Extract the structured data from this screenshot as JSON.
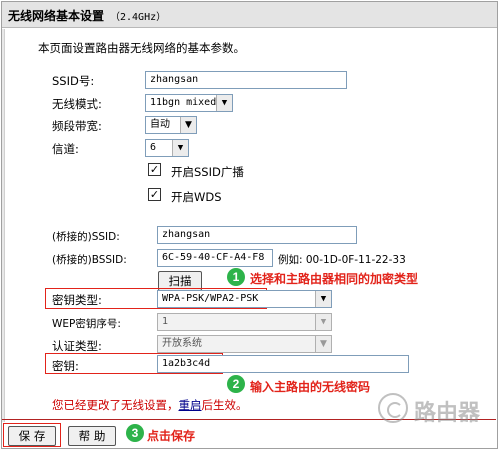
{
  "header": {
    "title": "无线网络基本设置",
    "band": "（2.4GHz）"
  },
  "intro": "本页面设置路由器无线网络的基本参数。",
  "form": {
    "ssid_label": "SSID号:",
    "ssid_value": "zhangsan",
    "mode_label": "无线模式:",
    "mode_value": "11bgn mixed",
    "bandwidth_label": "频段带宽:",
    "bandwidth_value": "自动",
    "channel_label": "信道:",
    "channel_value": "6",
    "ssid_broadcast_label": "开启SSID广播",
    "ssid_broadcast_checked": true,
    "wds_label": "开启WDS",
    "wds_checked": true,
    "bridge_ssid_label": "(桥接的)SSID:",
    "bridge_ssid_value": "zhangsan",
    "bridge_bssid_label": "(桥接的)BSSID:",
    "bridge_bssid_value": "6C-59-40-CF-A4-F8",
    "bssid_example": "例如: 00-1D-0F-11-22-33",
    "scan_button": "扫描",
    "key_type_label": "密钥类型:",
    "key_type_value": "WPA-PSK/WPA2-PSK",
    "wep_index_label": "WEP密钥序号:",
    "wep_index_value": "1",
    "auth_type_label": "认证类型:",
    "auth_type_value": "开放系统",
    "key_label": "密钥:",
    "key_value": "1a2b3c4d"
  },
  "warning": {
    "prefix": "您已经更改了无线设置，",
    "link": "重启",
    "suffix": "后生效。"
  },
  "buttons": {
    "save": "保 存",
    "help": "帮 助"
  },
  "annotations": {
    "step1_num": "1",
    "step1_text": "选择和主路由器相同的加密类型",
    "step2_num": "2",
    "step2_text": "输入主路由的无线密码",
    "step3_num": "3",
    "step3_text": "点击保存"
  },
  "watermark": {
    "text": "路由器"
  },
  "colors": {
    "accent_red": "#e2231a",
    "badge_green": "#2db34a"
  }
}
